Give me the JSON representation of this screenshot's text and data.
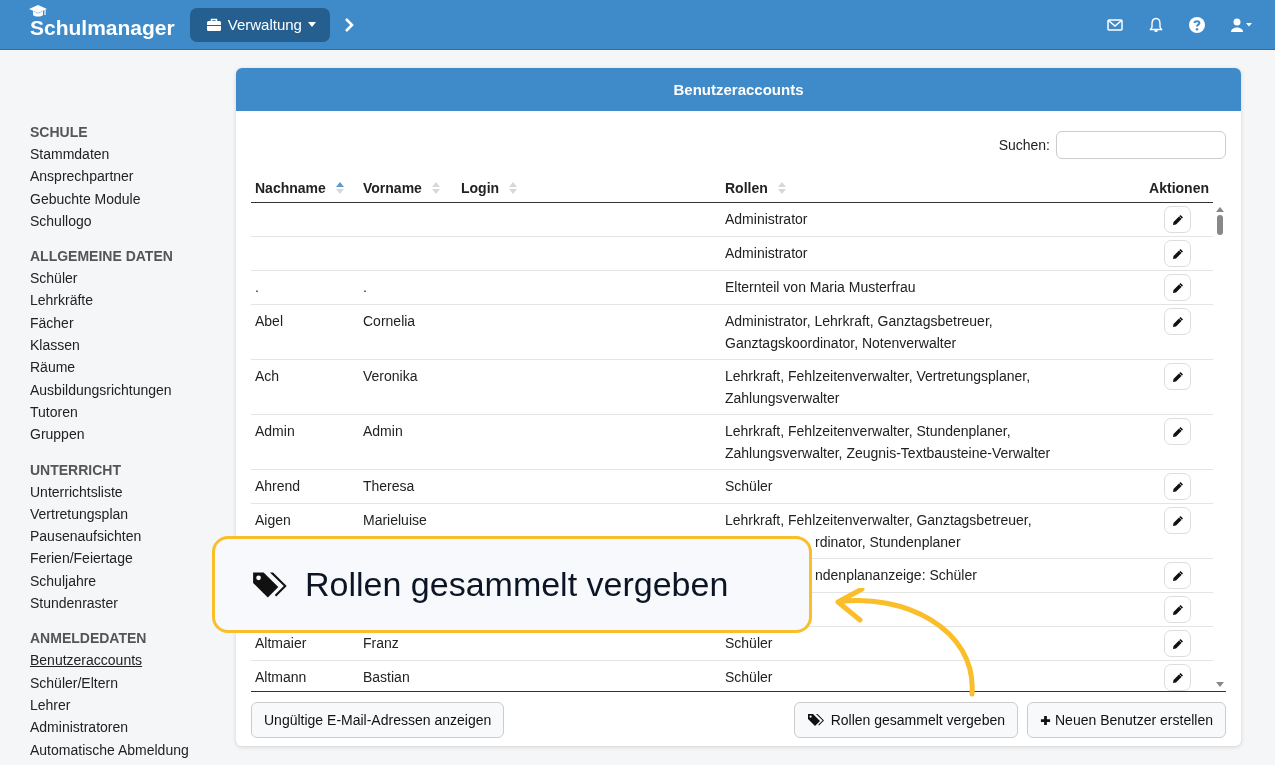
{
  "navbar": {
    "brand": "Schulmanager",
    "menu": {
      "label": "Verwaltung"
    }
  },
  "sidebar": {
    "sections": [
      {
        "title": "SCHULE",
        "items": [
          {
            "label": "Stammdaten",
            "selected": false
          },
          {
            "label": "Ansprechpartner",
            "selected": false
          },
          {
            "label": "Gebuchte Module",
            "selected": false
          },
          {
            "label": "Schullogo",
            "selected": false
          }
        ]
      },
      {
        "title": "ALLGEMEINE DATEN",
        "items": [
          {
            "label": "Schüler",
            "selected": false
          },
          {
            "label": "Lehrkräfte",
            "selected": false
          },
          {
            "label": "Fächer",
            "selected": false
          },
          {
            "label": "Klassen",
            "selected": false
          },
          {
            "label": "Räume",
            "selected": false
          },
          {
            "label": "Ausbildungsrichtungen",
            "selected": false
          },
          {
            "label": "Tutoren",
            "selected": false
          },
          {
            "label": "Gruppen",
            "selected": false
          }
        ]
      },
      {
        "title": "UNTERRICHT",
        "items": [
          {
            "label": "Unterrichtsliste",
            "selected": false
          },
          {
            "label": "Vertretungsplan",
            "selected": false
          },
          {
            "label": "Pausenaufsichten",
            "selected": false
          },
          {
            "label": "Ferien/Feiertage",
            "selected": false
          },
          {
            "label": "Schuljahre",
            "selected": false
          },
          {
            "label": "Stundenraster",
            "selected": false
          }
        ]
      },
      {
        "title": "ANMELDEDATEN",
        "items": [
          {
            "label": "Benutzeraccounts",
            "selected": true
          },
          {
            "label": "Schüler/Eltern",
            "selected": false
          },
          {
            "label": "Lehrer",
            "selected": false
          },
          {
            "label": "Administratoren",
            "selected": false
          },
          {
            "label": "Automatische Abmeldung",
            "selected": false
          }
        ]
      }
    ]
  },
  "card": {
    "title": "Benutzeraccounts",
    "search": {
      "label": "Suchen:"
    },
    "table": {
      "columns": [
        {
          "label": "Nachname",
          "sort_ascending": true
        },
        {
          "label": "Vorname",
          "sort_ascending": false
        },
        {
          "label": "Login",
          "sort_ascending": false
        },
        {
          "label": "Rollen",
          "sort_ascending": false
        },
        {
          "label": "Aktionen"
        }
      ],
      "rows": [
        {
          "last": "",
          "first": "",
          "roles": [
            "Administrator"
          ]
        },
        {
          "last": "",
          "first": "",
          "roles": [
            "Administrator"
          ]
        },
        {
          "last": ".",
          "first": ".",
          "roles": [
            "Elternteil von Maria Musterfrau"
          ]
        },
        {
          "last": "Abel",
          "first": "Cornelia",
          "roles": [
            "Administrator, Lehrkraft, Ganztagsbetreuer,",
            "Ganztagskoordinator, Notenverwalter"
          ]
        },
        {
          "last": "Ach",
          "first": "Veronika",
          "roles": [
            "Lehrkraft, Fehlzeitenverwalter, Vertretungsplaner,",
            "Zahlungsverwalter"
          ]
        },
        {
          "last": "Admin",
          "first": "Admin",
          "roles": [
            "Lehrkraft, Fehlzeitenverwalter, Stundenplaner,",
            "Zahlungsverwalter, Zeugnis-Textbausteine-Verwalter"
          ]
        },
        {
          "last": "Ahrend",
          "first": "Theresa",
          "roles": [
            "Schüler"
          ]
        },
        {
          "last": "Aigen",
          "first": "Marieluise",
          "roles": [
            "Lehrkraft, Fehlzeitenverwalter, Ganztagsbetreuer,",
            "rdinator, Stundenplaner"
          ],
          "clipped": true
        },
        {
          "last": "",
          "first": "",
          "roles": [
            "ndenplananzeige: Schüler"
          ],
          "clipped": true
        },
        {
          "last": "",
          "first": "",
          "roles": []
        },
        {
          "last": "Altmaier",
          "first": "Franz",
          "roles": [
            "Schüler"
          ]
        },
        {
          "last": "Altmann",
          "first": "Bastian",
          "roles": [
            "Schüler"
          ]
        }
      ]
    },
    "buttons": [
      {
        "kind": "plain",
        "label": "Ungültige E-Mail-Adressen anzeigen"
      },
      {
        "kind": "tag",
        "label": "Rollen gesammelt vergeben"
      },
      {
        "kind": "plus",
        "label": "Neuen Benutzer erstellen"
      }
    ]
  },
  "callout": {
    "text": "Rollen gesammelt vergeben"
  }
}
